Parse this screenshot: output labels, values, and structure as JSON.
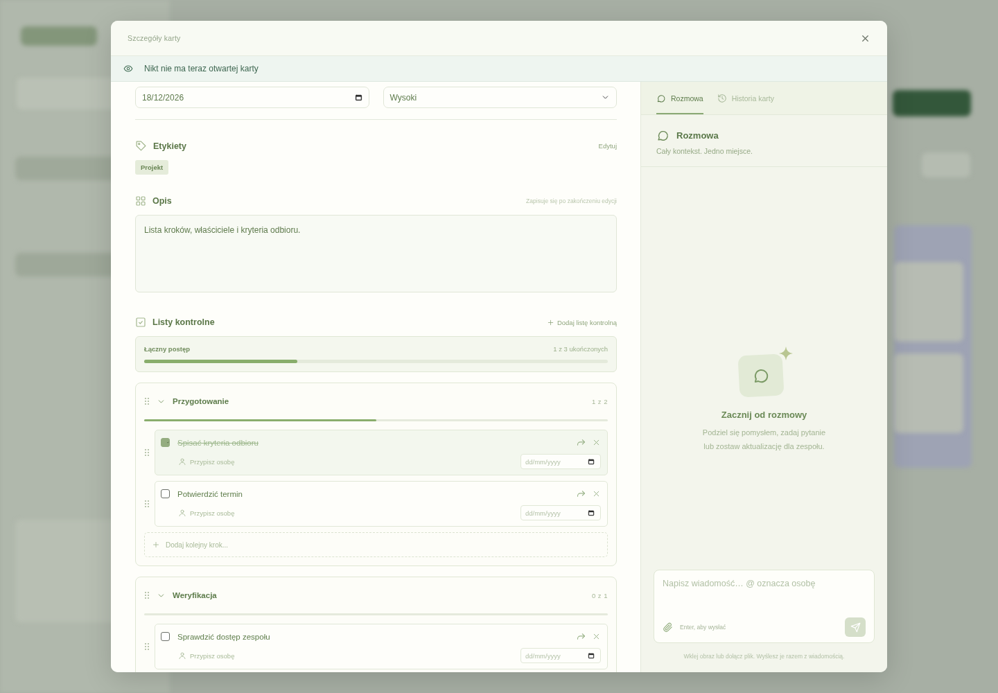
{
  "dialog": {
    "title": "Szczegóły karty"
  },
  "presence_banner": {
    "text": "Nikt nie ma teraz otwartej karty"
  },
  "due_date": {
    "value": "18/12/2026"
  },
  "priority": {
    "value": "Wysoki"
  },
  "labels_section": {
    "title": "Etykiety",
    "action": "Edytuj",
    "labels": [
      {
        "text": "Projekt"
      }
    ]
  },
  "description": {
    "title": "Opis",
    "hint": "Zapisuje się po zakończeniu edycji",
    "value": "Lista kroków, właściciele i kryteria odbioru."
  },
  "checklists_section": {
    "title": "Listy kontrolne",
    "action": "Dodaj listę kontrolną",
    "overall_label": "Łączny postęp",
    "overall_count": "1 z 3 ukończonych",
    "level": 0.33
  },
  "checklists": [
    {
      "title": "Przygotowanie",
      "count": "1 z 2",
      "expanded": true,
      "level": 0.5,
      "add_placeholder": "Dodaj kolejny krok...",
      "items": [
        {
          "text": "Spisać kryteria odbioru",
          "checked": true,
          "assignee": "Przypisz osobę",
          "date_placeholder": "dd/mm/yyyy"
        },
        {
          "text": "Potwierdzić termin",
          "checked": false,
          "assignee": "Przypisz osobę",
          "date_placeholder": "dd/mm/yyyy"
        }
      ]
    },
    {
      "title": "Weryfikacja",
      "count": "0 z 1",
      "expanded": true,
      "level": 0,
      "items": [
        {
          "text": "Sprawdzić dostęp zespołu",
          "checked": false,
          "assignee": "Przypisz osobę",
          "date_placeholder": "dd/mm/yyyy"
        }
      ]
    }
  ],
  "side_panel": {
    "tabs": [
      {
        "label": "Rozmowa",
        "kind": "chat",
        "selected": true
      },
      {
        "label": "Historia karty",
        "kind": "history",
        "selected": false
      }
    ],
    "heading": "Rozmowa",
    "subheading": "Cały kontekst. Jedno miejsce.",
    "empty_title": "Zacznij od rozmowy",
    "empty_text": "Podziel się pomysłem, zadaj pytanie lub zostaw aktualizację dla zespołu.",
    "composer": {
      "placeholder": "Napisz wiadomość… @ oznacza osobę",
      "hint": "Enter, aby wysłać"
    },
    "footnote": "Wklej obraz lub dołącz plik. Wyślesz je razem z wiadomością."
  }
}
